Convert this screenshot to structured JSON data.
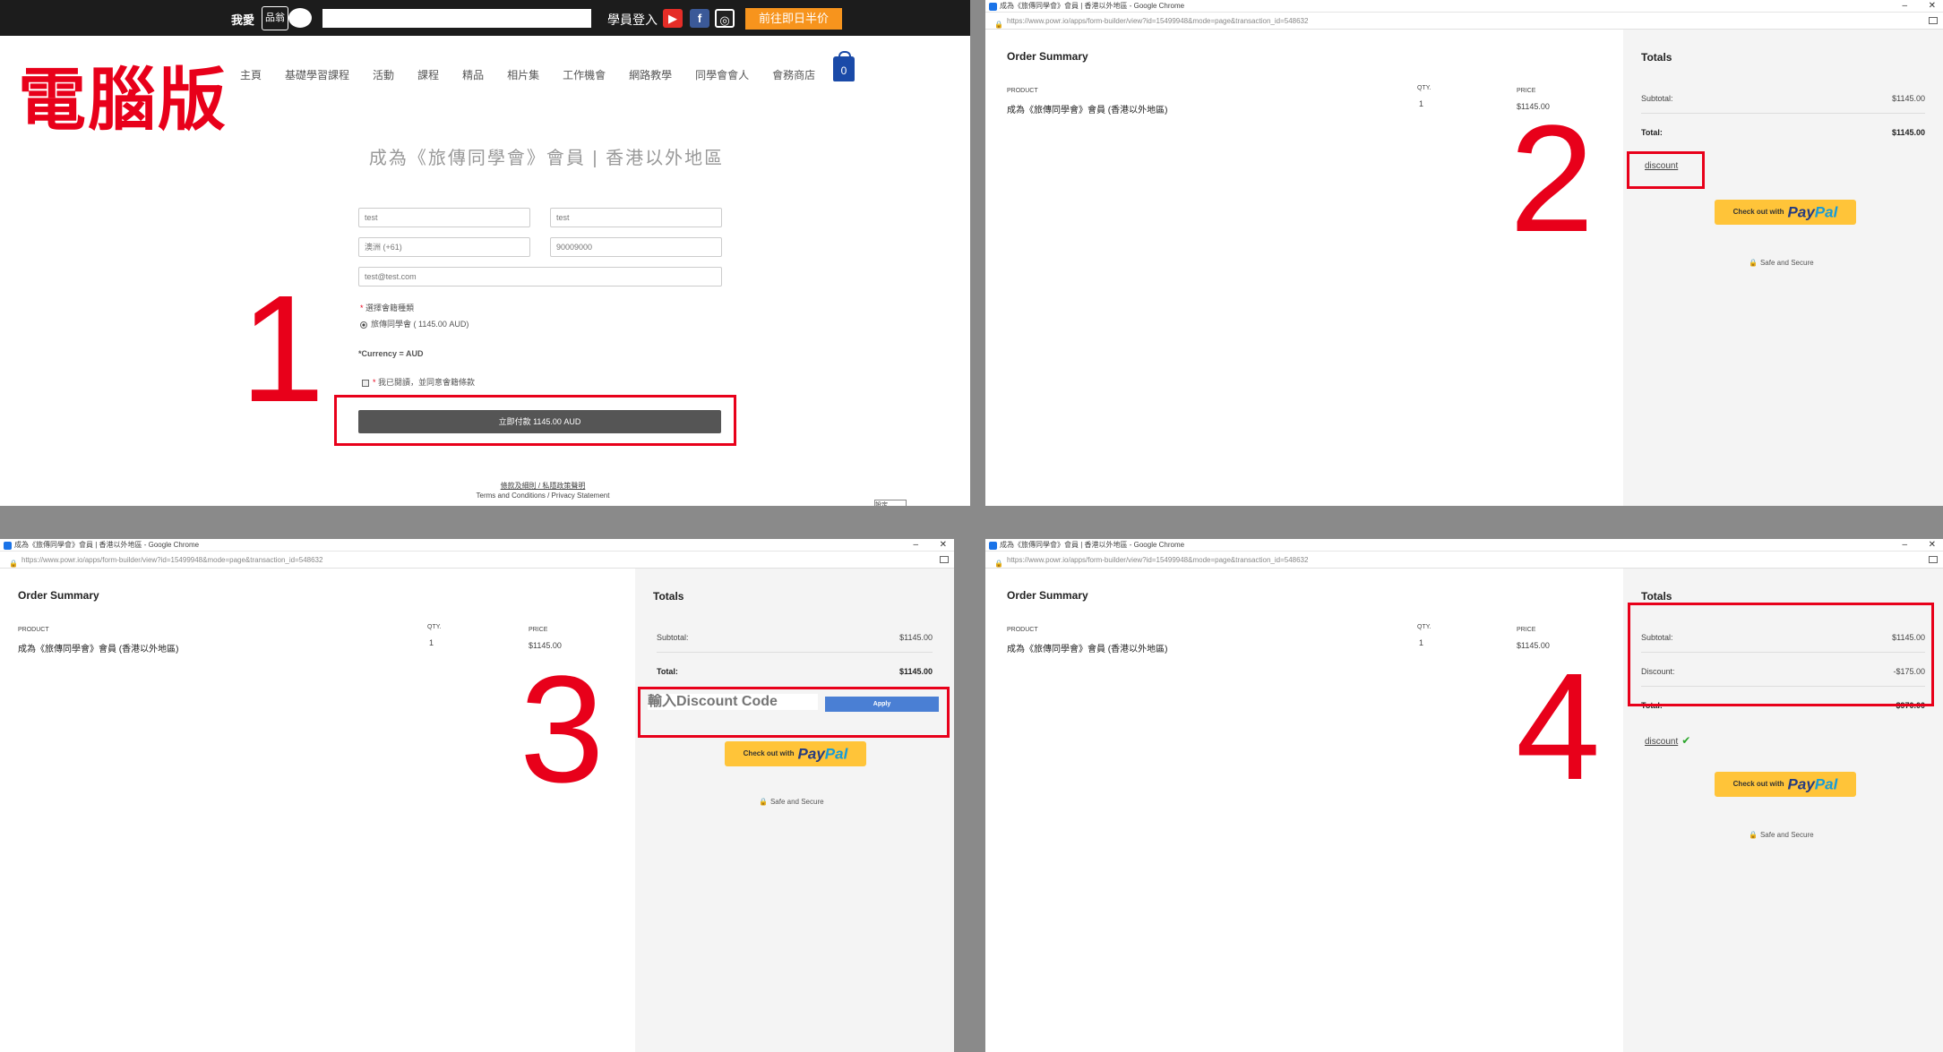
{
  "panel1": {
    "big_label": "電腦版",
    "step": "1",
    "logo_text": "我愛",
    "logo_badge": "品翁",
    "member_login": "學員登入",
    "top_cta": "前往即日半价",
    "nav": [
      "主頁",
      "基礎學習課程",
      "活動",
      "課程",
      "精品",
      "相片集",
      "工作機會",
      "網路教學",
      "同學會會人",
      "會務商店"
    ],
    "cart_count": "0",
    "form_title": "成為《旅傳同學會》會員 | 香港以外地區",
    "fields": {
      "first_name": "test",
      "last_name": "test",
      "country_code": "澳洲 (+61)",
      "phone": "90009000",
      "email": "test@test.com"
    },
    "plan_label": "選擇會籍種類",
    "plan_option": "旅傳同學會 ( 1145.00 AUD)",
    "currency": "*Currency = AUD",
    "agree": "我已閱讀，並同意會籍條款",
    "pay_button": "立即付款 1145.00 AUD",
    "footer_links": "條款及細則 / 私隱政策聲明",
    "footer_terms": "Terms and Conditions / Privacy Statement",
    "footer_btn": "設定"
  },
  "browser": {
    "title": "成為《旅傳同學會》會員 | 香港以外地區 - Google Chrome",
    "url": "https://www.powr.io/apps/form-builder/view?id=15499948&mode=page&transaction_id=548632",
    "min": "–",
    "max": "❐",
    "close": "✕"
  },
  "order": {
    "title": "Order Summary",
    "col_product": "PRODUCT",
    "col_qty": "QTY.",
    "col_price": "PRICE",
    "product": "成為《旅傳同學會》會員 (香港以外地區)",
    "qty": "1",
    "price": "$1145.00"
  },
  "totals": {
    "title": "Totals",
    "subtotal_label": "Subtotal:",
    "subtotal": "$1145.00",
    "discount_label": "Discount:",
    "discount": "-$175.00",
    "total_label": "Total:",
    "total": "$1145.00",
    "total_after": "$970.00",
    "discount_link": "discount",
    "paypal_prefix": "Check out with",
    "paypal_word1": "Pay",
    "paypal_word2": "Pal",
    "safe": "Safe and Secure"
  },
  "panel2": {
    "step": "2"
  },
  "panel3": {
    "step": "3",
    "discount_placeholder": "輸入Discount Code",
    "apply": "Apply"
  },
  "panel4": {
    "step": "4"
  },
  "colors": {
    "annotation_red": "#e8001a",
    "paypal_yellow": "#ffc439",
    "apply_blue": "#4a7fd4",
    "cart_blue": "#1a4aa8",
    "cta_orange": "#f7941d"
  }
}
